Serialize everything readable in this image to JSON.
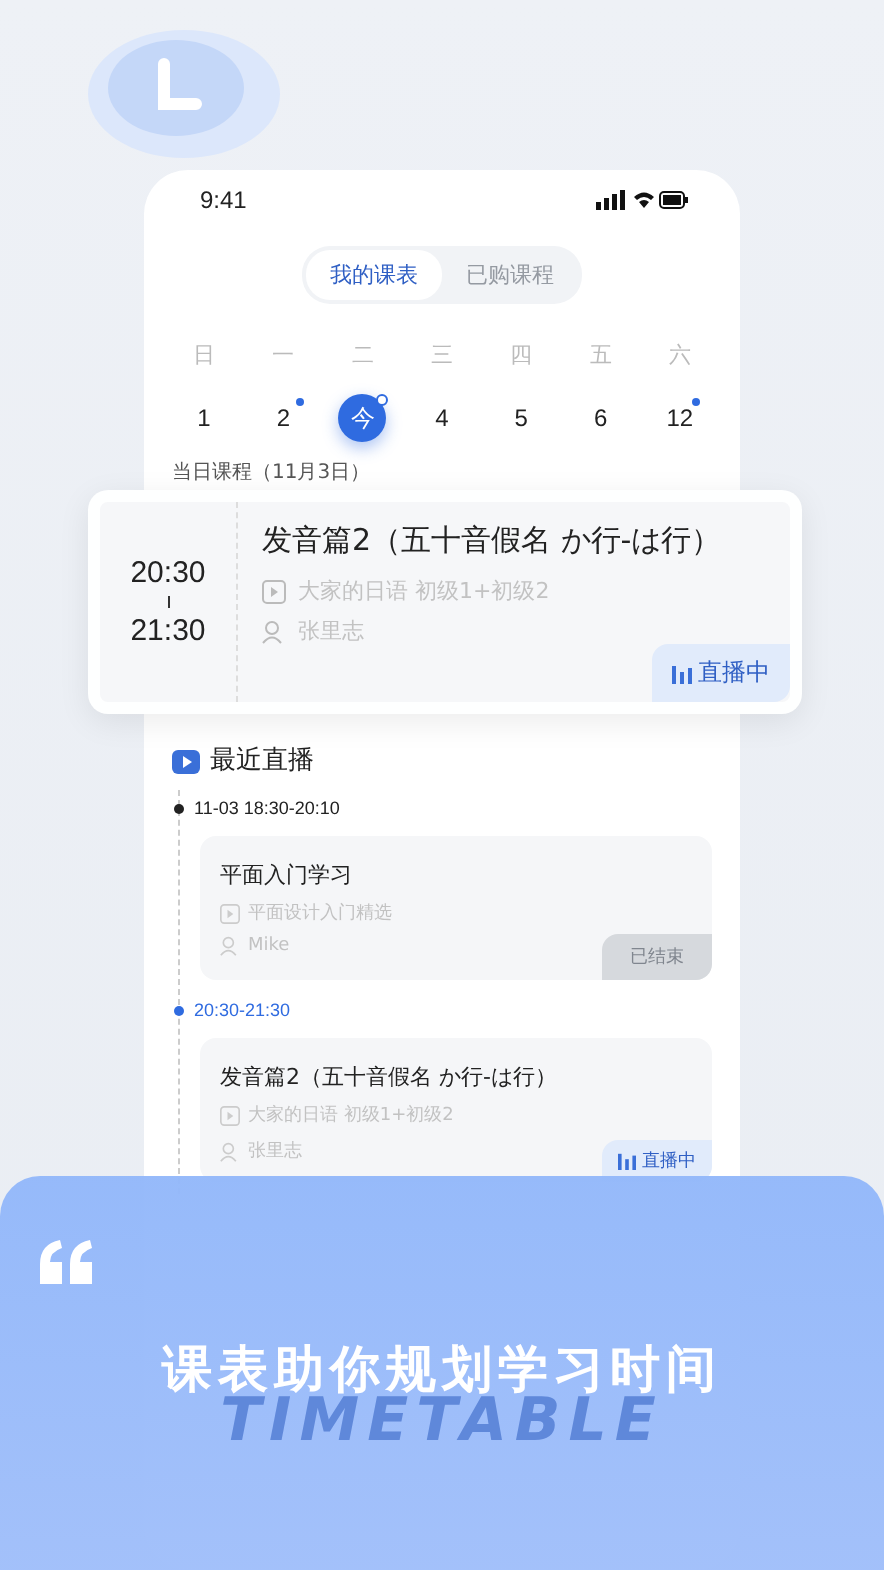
{
  "status_bar": {
    "time": "9:41"
  },
  "tabs": [
    {
      "label": "我的课表",
      "selected": true
    },
    {
      "label": "已购课程",
      "selected": false
    }
  ],
  "weekdays": [
    "日",
    "一",
    "二",
    "三",
    "四",
    "五",
    "六"
  ],
  "dates": [
    {
      "label": "1",
      "has_class": false,
      "today": false
    },
    {
      "label": "2",
      "has_class": true,
      "today": false
    },
    {
      "label": "今",
      "has_class": true,
      "today": true
    },
    {
      "label": "4",
      "has_class": false,
      "today": false
    },
    {
      "label": "5",
      "has_class": false,
      "today": false
    },
    {
      "label": "6",
      "has_class": false,
      "today": false
    },
    {
      "label": "12",
      "has_class": true,
      "today": false
    }
  ],
  "today_heading": "当日课程（11月3日）",
  "featured_lesson": {
    "start": "20:30",
    "end": "21:30",
    "title": "发音篇2（五十音假名 か行-は行）",
    "course": "大家的日语 初级1+初级2",
    "teacher": "张里志",
    "status": {
      "kind": "live",
      "label": "直播中"
    }
  },
  "recent": {
    "title": "最近直播",
    "items": [
      {
        "time": "11-03 18:30-20:10",
        "current": false,
        "title": "平面入门学习",
        "course": "平面设计入门精选",
        "teacher": "Mike",
        "status": {
          "kind": "ended",
          "label": "已结束"
        }
      },
      {
        "time": "20:30-21:30",
        "current": true,
        "title": "发音篇2（五十音假名 か行-は行）",
        "course": "大家的日语 初级1+初级2",
        "teacher": "张里志",
        "status": {
          "kind": "live",
          "label": "直播中"
        }
      }
    ]
  },
  "promo": {
    "headline": "课表助你规划学习时间",
    "subtitle": "TIMETABLE"
  }
}
